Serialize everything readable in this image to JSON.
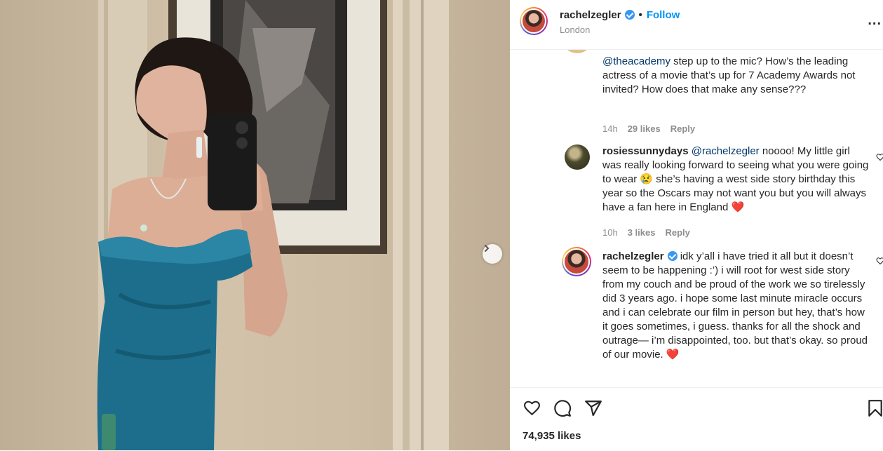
{
  "post": {
    "username": "rachelzegler",
    "separator": "•",
    "follow_label": "Follow",
    "location": "London",
    "more_label": "...",
    "likes": "74,935 likes"
  },
  "comments": {
    "first": {
      "mention": "@theacademy",
      "text": " step up to the mic? How’s the leading actress of a movie that’s up for 7 Academy Awards not invited? How does that make any sense???",
      "time": "14h",
      "likes": "29 likes",
      "reply": "Reply"
    },
    "second": {
      "username": "rosiessunnydays",
      "mention": "@rachelzegler",
      "text": " noooo! My little girl was really looking forward to seeing what you were going to wear 😢 she’s having a west side story birthday this year so the Oscars may not want you but you will always have a fan here in England ❤️",
      "time": "10h",
      "likes": "3 likes",
      "reply": "Reply"
    },
    "third": {
      "username": "rachelzegler",
      "text": " idk y’all i have tried it all but it doesn’t seem to be happening :’) i will root for west side story from my couch and be proud of the work we so tirelessly did 3 years ago. i hope some last minute miracle occurs and i can celebrate our film in person but hey, that’s how it goes sometimes, i guess. thanks for all the shock and outrage— i’m disappointed, too. but that’s okay. so proud of our movie. ❤️"
    }
  },
  "icons": {
    "like": "heart-icon",
    "comment": "comment-icon",
    "share": "paper-plane-icon",
    "save": "bookmark-icon",
    "next": "chevron-right-icon"
  },
  "colors": {
    "link": "#0095f6",
    "mention": "#00376b",
    "verified": "#3897f0",
    "muted": "#8e8e8e",
    "dress": "#1c6e8c"
  }
}
